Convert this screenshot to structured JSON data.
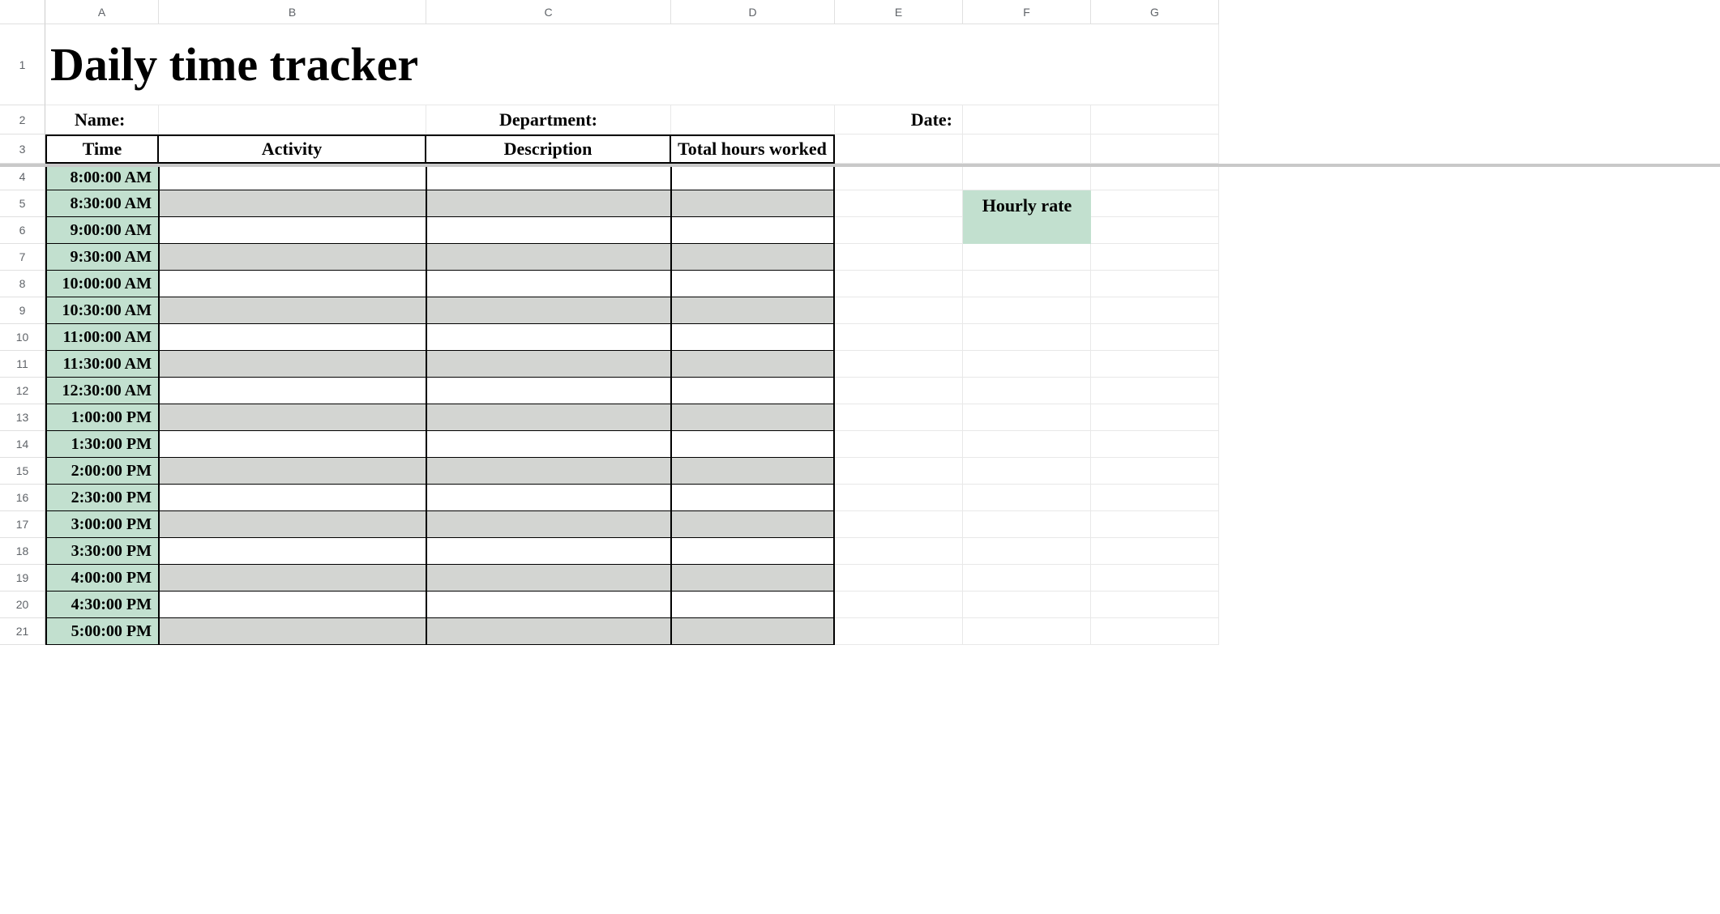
{
  "columns": [
    "A",
    "B",
    "C",
    "D",
    "E",
    "F",
    "G"
  ],
  "rows": [
    "1",
    "2",
    "3",
    "4",
    "5",
    "6",
    "7",
    "8",
    "9",
    "10",
    "11",
    "12",
    "13",
    "14",
    "15",
    "16",
    "17",
    "18",
    "19",
    "20",
    "21"
  ],
  "title": "Daily time tracker",
  "labels": {
    "name": "Name:",
    "department": "Department:",
    "date": "Date:",
    "hourly_rate": "Hourly rate"
  },
  "headers": {
    "time": "Time",
    "activity": "Activity",
    "description": "Description",
    "total": "Total hours worked"
  },
  "times": [
    "8:00:00 AM",
    "8:30:00 AM",
    "9:00:00 AM",
    "9:30:00 AM",
    "10:00:00 AM",
    "10:30:00 AM",
    "11:00:00 AM",
    "11:30:00 AM",
    "12:30:00 AM",
    "1:00:00 PM",
    "1:30:00 PM",
    "2:00:00 PM",
    "2:30:00 PM",
    "3:00:00 PM",
    "3:30:00 PM",
    "4:00:00 PM",
    "4:30:00 PM",
    "5:00:00 PM"
  ]
}
